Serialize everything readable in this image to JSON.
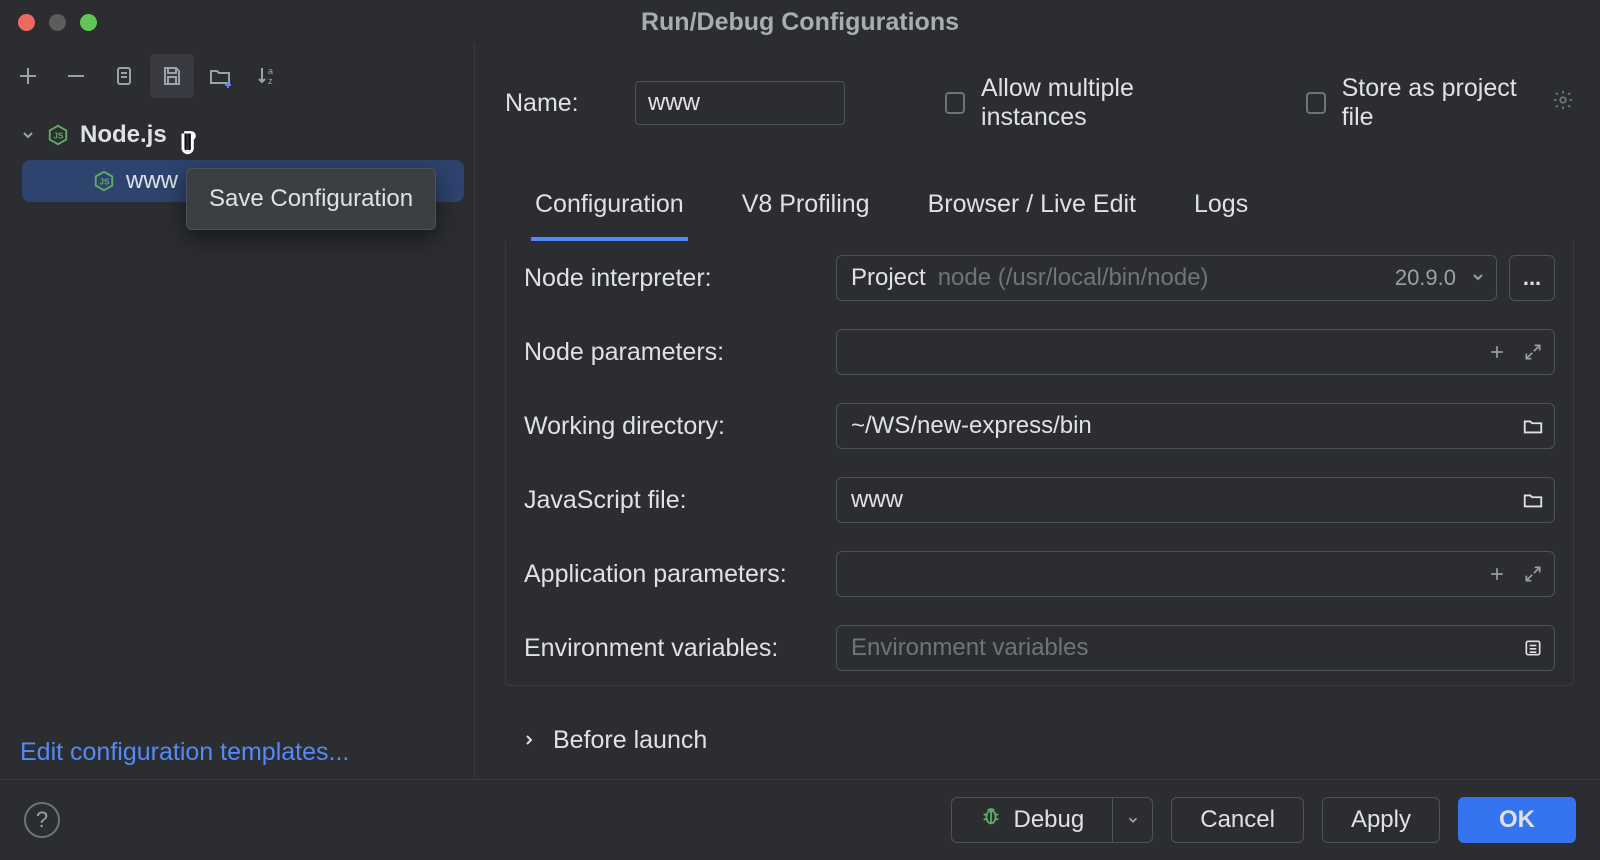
{
  "window": {
    "title": "Run/Debug Configurations"
  },
  "tooltip": {
    "save": "Save Configuration"
  },
  "tree": {
    "root_label": "Node.js",
    "items": [
      {
        "label": "www"
      }
    ]
  },
  "sidebar": {
    "edit_templates": "Edit configuration templates..."
  },
  "form": {
    "name_label": "Name:",
    "name_value": "www",
    "allow_multiple": "Allow multiple instances",
    "store_project": "Store as project file"
  },
  "tabs": {
    "configuration": "Configuration",
    "v8": "V8 Profiling",
    "browser": "Browser / Live Edit",
    "logs": "Logs"
  },
  "fields": {
    "node_interpreter_label": "Node interpreter:",
    "node_interpreter_prefix": "Project",
    "node_interpreter_path": "node (/usr/local/bin/node)",
    "node_version": "20.9.0",
    "node_parameters_label": "Node parameters:",
    "working_dir_label": "Working directory:",
    "working_dir_value": "~/WS/new-express/bin",
    "js_file_label": "JavaScript file:",
    "js_file_value": "www",
    "app_params_label": "Application parameters:",
    "env_vars_label": "Environment variables:",
    "env_vars_placeholder": "Environment variables"
  },
  "before_launch": "Before launch",
  "footer": {
    "debug": "Debug",
    "cancel": "Cancel",
    "apply": "Apply",
    "ok": "OK"
  }
}
